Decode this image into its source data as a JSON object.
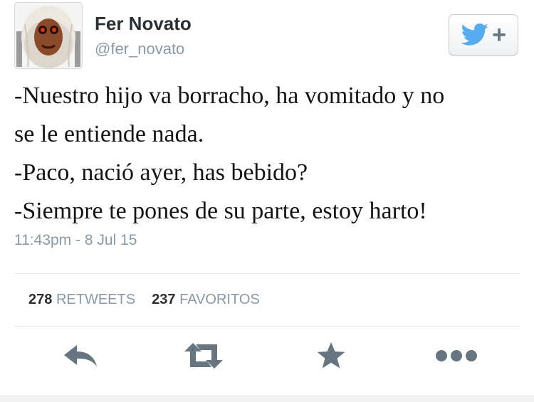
{
  "user": {
    "display_name": "Fer Novato",
    "handle": "@fer_novato"
  },
  "follow_button": {
    "icon": "twitter-bird-icon",
    "symbol": "+",
    "bird_color": "#55acee"
  },
  "tweet": {
    "lines": [
      "-Nuestro hijo va borracho, ha vomitado y no",
      "se le entiende nada.",
      "-Paco, nació ayer, has bebido?",
      "-Siempre te pones de su parte, estoy harto!"
    ],
    "timestamp": "11:43pm - 8 Jul 15"
  },
  "stats": {
    "retweets_count": "278",
    "retweets_label": "RETWEETS",
    "favorites_count": "237",
    "favorites_label": "FAVORITOS"
  },
  "actions": [
    {
      "name": "reply",
      "icon": "reply-icon"
    },
    {
      "name": "retweet",
      "icon": "retweet-icon"
    },
    {
      "name": "favorite",
      "icon": "star-icon"
    },
    {
      "name": "more",
      "icon": "more-dots-icon"
    }
  ],
  "colors": {
    "icon_gray": "#66757f",
    "secondary_text": "#8899a6"
  }
}
